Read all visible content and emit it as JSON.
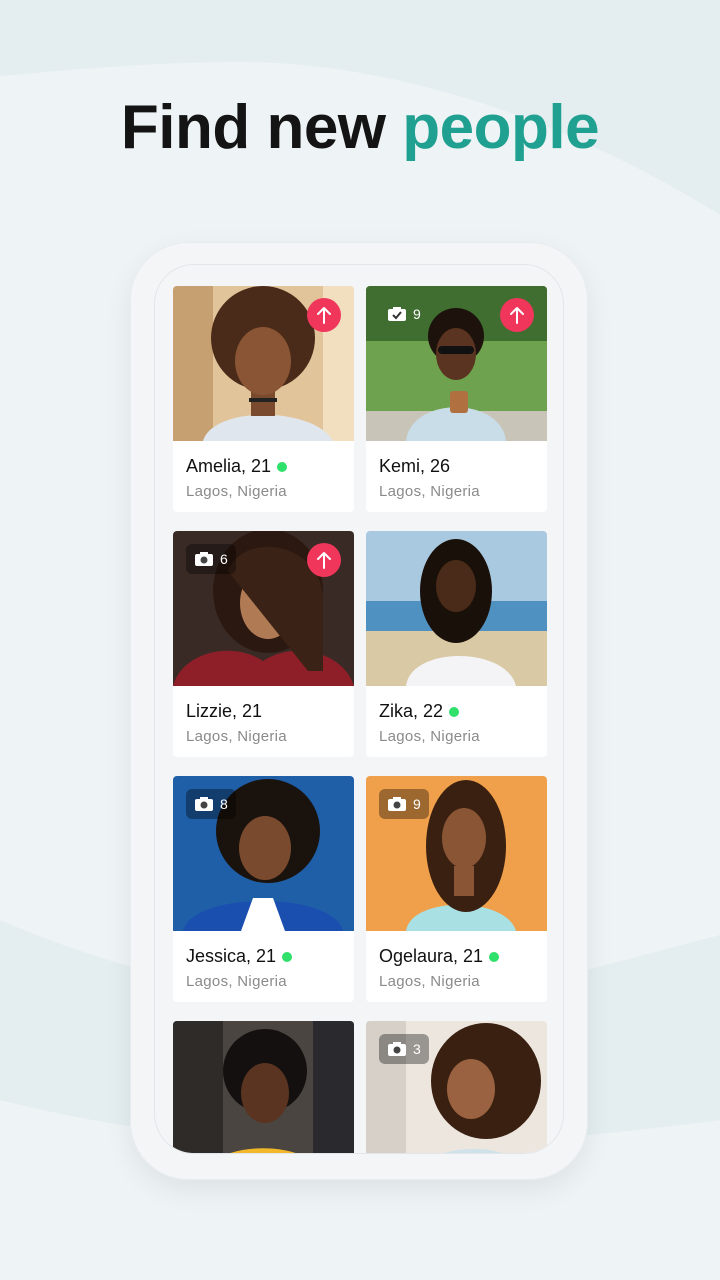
{
  "headline": {
    "plain": "Find new",
    "accent": "people"
  },
  "colors": {
    "accent": "#20a090",
    "boost": "#f0365a",
    "online": "#2fe06a",
    "background": "#eef3f5"
  },
  "profiles": [
    {
      "name_age": "Amelia, 21",
      "location": "Lagos, Nigeria",
      "online": true,
      "boosted": true,
      "photo_count": "",
      "verified": false,
      "bg": "#d9b68c"
    },
    {
      "name_age": "Kemi, 26",
      "location": "Lagos, Nigeria",
      "online": false,
      "boosted": true,
      "photo_count": "9",
      "verified": true,
      "bg": "#5d8f4a"
    },
    {
      "name_age": "Lizzie, 21",
      "location": "Lagos, Nigeria",
      "online": false,
      "boosted": true,
      "photo_count": "6",
      "verified": false,
      "bg": "#3a2a26"
    },
    {
      "name_age": "Zika, 22",
      "location": "Lagos, Nigeria",
      "online": true,
      "boosted": false,
      "photo_count": "",
      "verified": false,
      "bg": "#8fb9d6"
    },
    {
      "name_age": "Jessica, 21",
      "location": "Lagos, Nigeria",
      "online": true,
      "boosted": false,
      "photo_count": "8",
      "verified": false,
      "bg": "#1e5fa8"
    },
    {
      "name_age": "Ogelaura, 21",
      "location": "Lagos, Nigeria",
      "online": true,
      "boosted": false,
      "photo_count": "9",
      "verified": false,
      "bg": "#f0a04a"
    },
    {
      "name_age": "",
      "location": "",
      "online": false,
      "boosted": false,
      "photo_count": "",
      "verified": false,
      "bg": "#4a4540"
    },
    {
      "name_age": "",
      "location": "",
      "online": false,
      "boosted": false,
      "photo_count": "3",
      "verified": false,
      "bg": "#e8e2dc"
    }
  ]
}
